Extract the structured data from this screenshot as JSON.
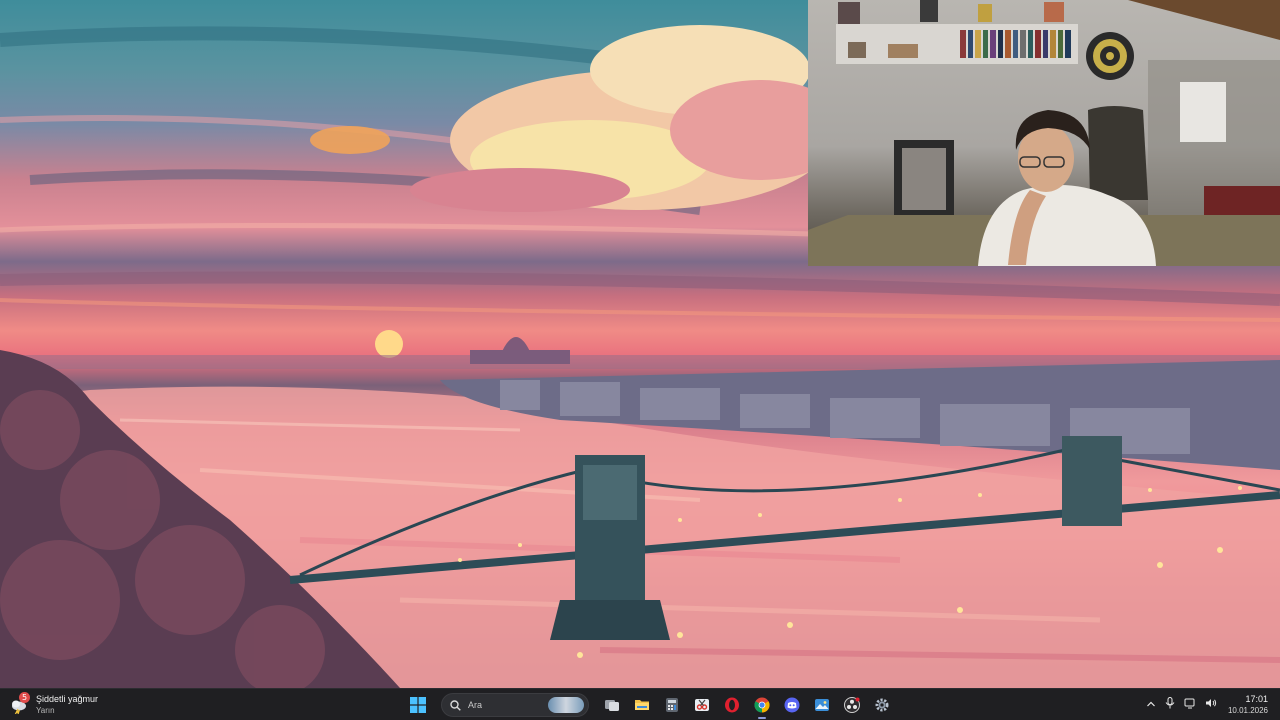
{
  "desktop": {
    "wallpaper": "sunset-city-bridge-painting"
  },
  "webcam": {
    "content": "person-at-desk-camera-feed"
  },
  "taskbar": {
    "weather": {
      "title": "Şiddetli yağmur",
      "subtitle": "Yarın",
      "badge": "5",
      "icon": "storm-cloud-icon"
    },
    "search": {
      "label": "Ara"
    },
    "apps": [
      {
        "name": "start-button",
        "icon": "windows-logo-icon"
      },
      {
        "name": "task-view",
        "icon": "task-view-icon"
      },
      {
        "name": "file-explorer",
        "icon": "folder-icon"
      },
      {
        "name": "calculator",
        "icon": "calculator-icon"
      },
      {
        "name": "snipping-tool",
        "icon": "snipping-icon"
      },
      {
        "name": "opera-browser",
        "icon": "opera-icon"
      },
      {
        "name": "chrome-browser",
        "icon": "chrome-icon"
      },
      {
        "name": "discord",
        "icon": "discord-icon"
      },
      {
        "name": "photos",
        "icon": "photos-icon"
      },
      {
        "name": "obs-studio",
        "icon": "obs-icon"
      },
      {
        "name": "settings",
        "icon": "gear-icon"
      }
    ],
    "tray": {
      "icons": [
        "chevron-up-icon",
        "microphone-icon",
        "display-icon",
        "volume-icon"
      ]
    },
    "clock": {
      "time": "17:01",
      "date": "10.01.2026"
    },
    "colors": {
      "background": "#1f1f22",
      "accent": "#8c9bd8"
    }
  }
}
